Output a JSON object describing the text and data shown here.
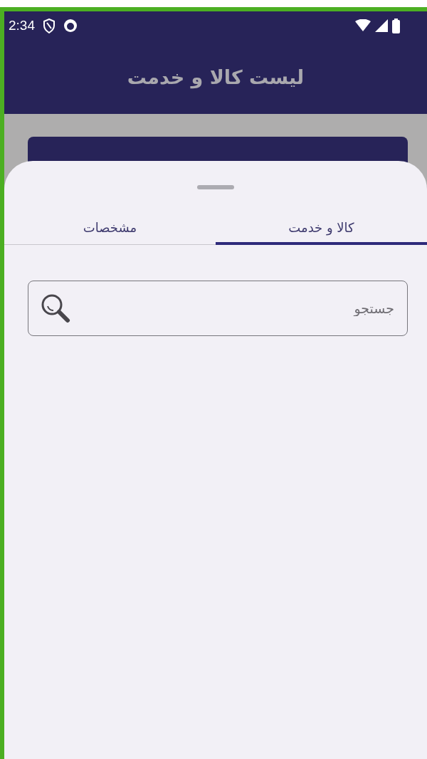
{
  "status_bar": {
    "time": "2:34"
  },
  "app_bar": {
    "title": "لیست کالا و خدمت"
  },
  "sheet": {
    "tabs": [
      {
        "label": "کالا و خدمت",
        "selected": true
      },
      {
        "label": "مشخصات",
        "selected": false
      }
    ],
    "search": {
      "placeholder": "جستجو"
    }
  }
}
